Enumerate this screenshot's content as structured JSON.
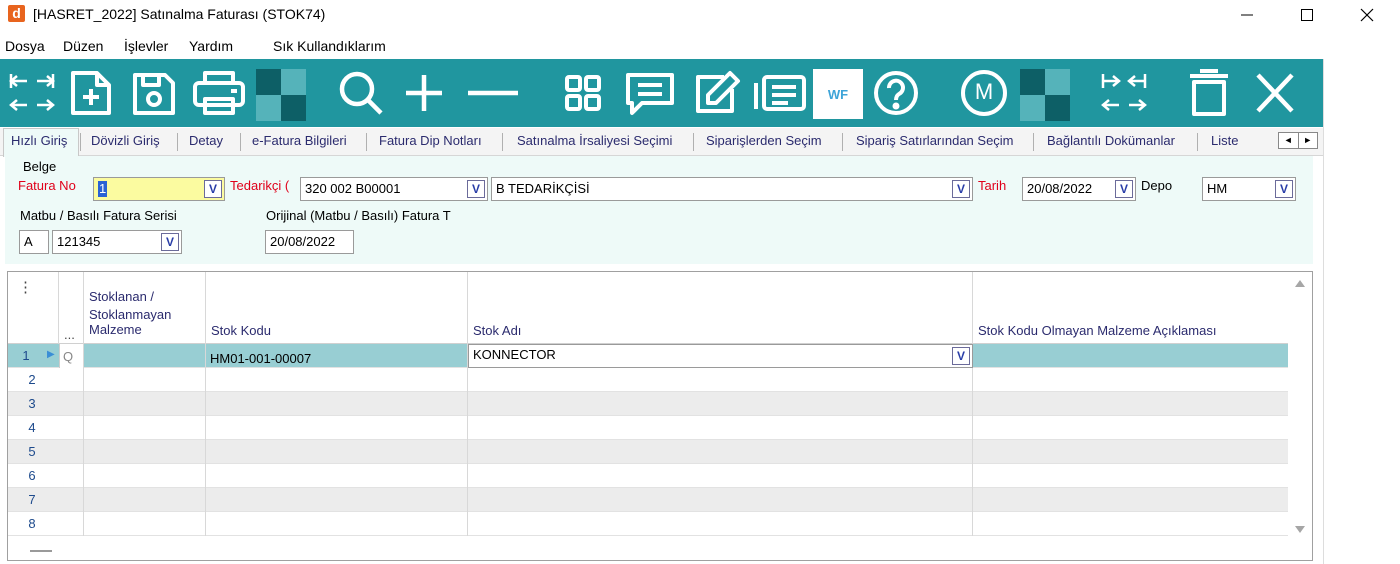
{
  "window": {
    "app_letter": "d",
    "title": "[HASRET_2022] Satınalma Faturası (STOK74)"
  },
  "menu": [
    "Dosya",
    "Düzen",
    "İşlevler",
    "Yardım",
    "Sık Kullandıklarım"
  ],
  "toolbar": {
    "wf_label": "WF",
    "m_label": "M"
  },
  "tabs": [
    "Hızlı Giriş",
    "Dövizli Giriş",
    "Detay",
    "e-Fatura Bilgileri",
    "Fatura Dip Notları",
    "Satınalma İrsaliyesi Seçimi",
    "Siparişlerden Seçim",
    "Sipariş Satırlarından Seçim",
    "Bağlantılı Dokümanlar",
    "Liste"
  ],
  "tab_scroll": {
    "left": "◄",
    "right": "►"
  },
  "form": {
    "belge_label": "Belge",
    "fatura_no_label": "Fatura No",
    "fatura_no_value": "1",
    "tedarikci_label": "Tedarikçi (",
    "tedarikci_kod": "320 002 B00001",
    "tedarikci_adi": "B TEDARİKÇİSİ",
    "tarih_label": "Tarih",
    "tarih_value": "20/08/2022",
    "depo_label": "Depo",
    "depo_value": "HM",
    "matbu_label": "Matbu / Basılı Fatura Serisi",
    "matbu_seri": "A",
    "matbu_no": "121345",
    "orijinal_label": "Orijinal (Matbu / Basılı) Fatura T",
    "orijinal_tarih": "20/08/2022",
    "dropdown_glyph": "V"
  },
  "grid": {
    "menu_glyph": "⋮",
    "dots_header": "...",
    "headers": {
      "stoklanan": [
        "Stoklanan /",
        "Stoklanmayan",
        "Malzeme"
      ],
      "stok_kodu": "Stok Kodu",
      "stok_adi": "Stok Adı",
      "aciklama": "Stok Kodu Olmayan Malzeme Açıklaması"
    },
    "rows": [
      {
        "num": "1",
        "stok_kodu": "HM01-001-00007",
        "stok_adi": "KONNECTOR"
      },
      {
        "num": "2",
        "stok_kodu": "",
        "stok_adi": ""
      },
      {
        "num": "3",
        "stok_kodu": "",
        "stok_adi": ""
      },
      {
        "num": "4",
        "stok_kodu": "",
        "stok_adi": ""
      },
      {
        "num": "5",
        "stok_kodu": "",
        "stok_adi": ""
      },
      {
        "num": "6",
        "stok_kodu": "",
        "stok_adi": ""
      },
      {
        "num": "7",
        "stok_kodu": "",
        "stok_adi": ""
      },
      {
        "num": "8",
        "stok_kodu": "",
        "stok_adi": ""
      }
    ],
    "row1_marker": "▶",
    "row1_search": "Q"
  },
  "colors": {
    "toolbar": "#20969f",
    "selected_row": "#98ced3",
    "required_label": "#e0001a",
    "form_bg": "#eefaf8"
  }
}
